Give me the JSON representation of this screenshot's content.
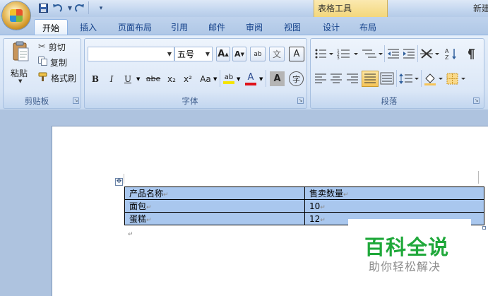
{
  "title_bar": {
    "contextual_label": "表格工具",
    "app_title_partial": "新建",
    "qat": {
      "save_icon": "save-icon",
      "undo_icon": "undo-icon",
      "redo_icon": "redo-icon",
      "more_icon": "customize-icon"
    }
  },
  "tabs": [
    {
      "label": "开始",
      "active": true
    },
    {
      "label": "插入"
    },
    {
      "label": "页面布局"
    },
    {
      "label": "引用"
    },
    {
      "label": "邮件"
    },
    {
      "label": "审阅"
    },
    {
      "label": "视图"
    },
    {
      "label": "设计"
    },
    {
      "label": "布局"
    }
  ],
  "clipboard": {
    "paste_label": "粘贴",
    "cut_label": "剪切",
    "copy_label": "复制",
    "format_painter_label": "格式刷",
    "group_label": "剪贴板"
  },
  "font": {
    "font_name_value": "",
    "font_size_value": "五号",
    "grow_glyph": "A",
    "shrink_glyph": "A",
    "clear_glyph": "ab",
    "phonetic_glyph": "文",
    "border_glyph": "A",
    "bold_glyph": "B",
    "italic_glyph": "I",
    "underline_glyph": "U",
    "strike_glyph": "abe",
    "subscript_glyph": "x₂",
    "superscript_glyph": "x²",
    "case_glyph": "Aa",
    "highlight_glyph": "ab",
    "color_glyph": "A",
    "shading_glyph": "A",
    "enclose_glyph": "字",
    "group_label": "字体"
  },
  "paragraph": {
    "group_label": "段落"
  },
  "colors": {
    "highlight": "#f5e400",
    "font_color": "#e0131a",
    "table_cell": "#a9c7ee",
    "watermark_green": "#1fa83a"
  },
  "table": {
    "rows": [
      [
        "产品名称",
        "售卖数量"
      ],
      [
        "面包",
        "10"
      ],
      [
        "蛋糕",
        "12"
      ]
    ]
  },
  "watermark": {
    "title": "百科全说",
    "subtitle": "助你轻松解决"
  }
}
